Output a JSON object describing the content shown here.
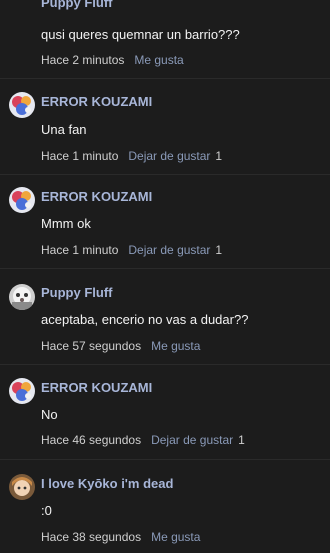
{
  "comments": [
    {
      "author": "Puppy Fluff",
      "text": "qusi queres quemnar un barrio???",
      "time": "Hace 2 minutos",
      "like_label": "Me gusta",
      "like_count": "",
      "avatar": "puppy-avatar"
    },
    {
      "author": "ERROR KOUZAMI",
      "text": "Una fan",
      "time": "Hace 1 minuto",
      "like_label": "Dejar de gustar",
      "like_count": "1",
      "avatar": "error-avatar"
    },
    {
      "author": "ERROR KOUZAMI",
      "text": "Mmm ok",
      "time": "Hace 1 minuto",
      "like_label": "Dejar de gustar",
      "like_count": "1",
      "avatar": "error-avatar"
    },
    {
      "author": "Puppy Fluff",
      "text": "aceptaba, encerio no vas a dudar??",
      "time": "Hace 57 segundos",
      "like_label": "Me gusta",
      "like_count": "",
      "avatar": "puppy-avatar"
    },
    {
      "author": "ERROR KOUZAMI",
      "text": "No",
      "time": "Hace 46 segundos",
      "like_label": "Dejar de gustar",
      "like_count": "1",
      "avatar": "error-avatar"
    },
    {
      "author": "I love Kyōko i'm dead",
      "text": ":0",
      "time": "Hace 38 segundos",
      "like_label": "Me gusta",
      "like_count": "",
      "avatar": "kyoko-avatar"
    }
  ]
}
